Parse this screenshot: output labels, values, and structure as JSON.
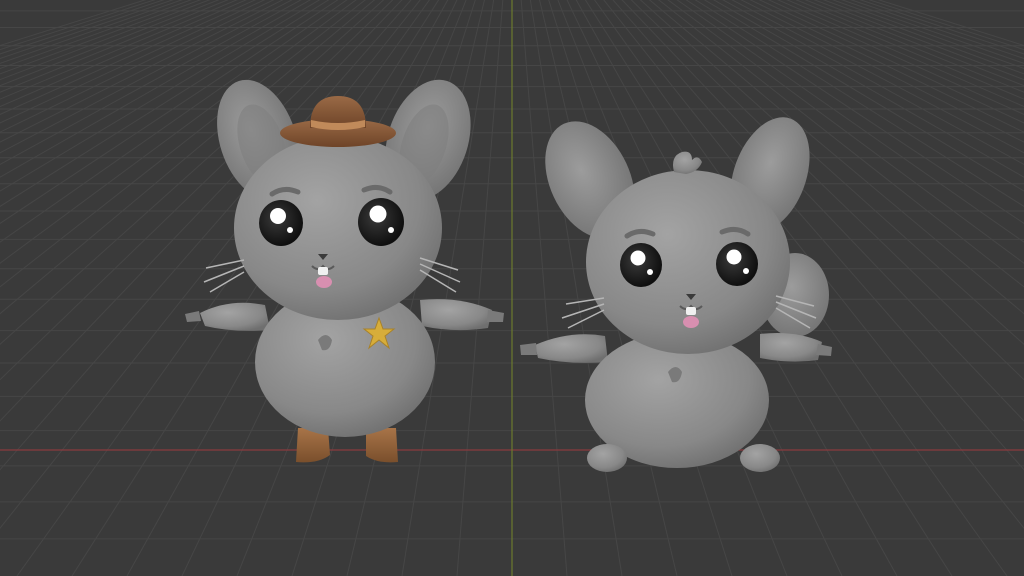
{
  "viewport": {
    "background_color": "#3a3a3a",
    "grid_color": "#464646",
    "x_axis_color": "#8a3b3f",
    "y_axis_color": "#6b7a2e"
  },
  "models": [
    {
      "name": "chinchilla-cowboy",
      "body_color": "#8e8e8e",
      "hat_color": "#8a5a3a",
      "hat_band_color": "#c08a5a",
      "boots_color": "#9a6a44",
      "badge_color": "#d7ad3a"
    },
    {
      "name": "chinchilla-sitting",
      "body_color": "#8e8e8e"
    }
  ]
}
